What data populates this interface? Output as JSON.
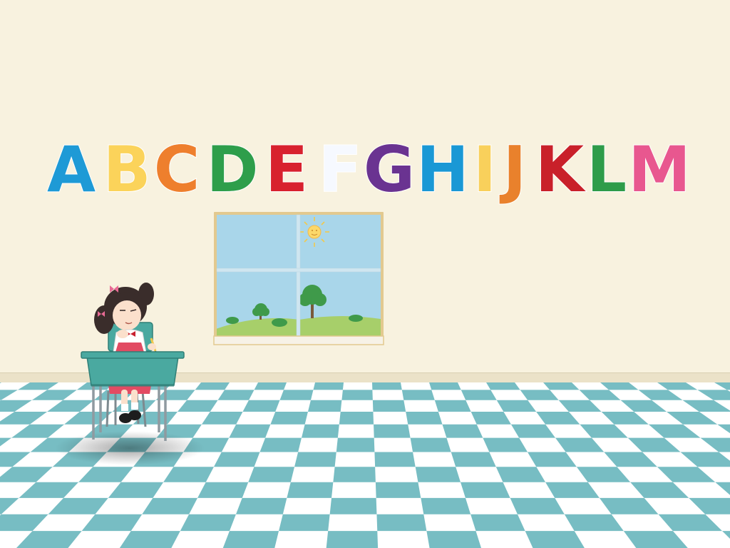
{
  "scene": {
    "wall_color": "#f8f2df",
    "baseboard_color": "#ebe2c8",
    "floor_tile_color": "#6fb9c0",
    "floor_light_color": "#ffffff"
  },
  "alphabet": [
    {
      "char": "A",
      "color": "#1e9ad6"
    },
    {
      "char": "B",
      "color": "#fbd35a"
    },
    {
      "char": "C",
      "color": "#ee7f2d"
    },
    {
      "char": "D",
      "color": "#2e9e4b"
    },
    {
      "char": "E",
      "color": "#d8212e"
    },
    {
      "char": "F",
      "color": "#f6f9ff"
    },
    {
      "char": "G",
      "color": "#6a3391"
    },
    {
      "char": "H",
      "color": "#1a98d5"
    },
    {
      "char": "I",
      "color": "#f9d05b"
    },
    {
      "char": "J",
      "color": "#e9812c"
    },
    {
      "char": "K",
      "color": "#c9202a"
    },
    {
      "char": "L",
      "color": "#2e9c4a"
    },
    {
      "char": "M",
      "color": "#e8578f"
    }
  ],
  "window": {
    "sky_color": "#a9d6ea",
    "frame_color": "#e2c98f",
    "hill_color": "#a7cf6a",
    "icons": [
      "sun-icon",
      "tree-icon",
      "bush-icon"
    ]
  },
  "student": {
    "desk_color": "#4aa9a0",
    "icons": [
      "girl-icon",
      "pencil-icon",
      "bow-icon"
    ]
  }
}
